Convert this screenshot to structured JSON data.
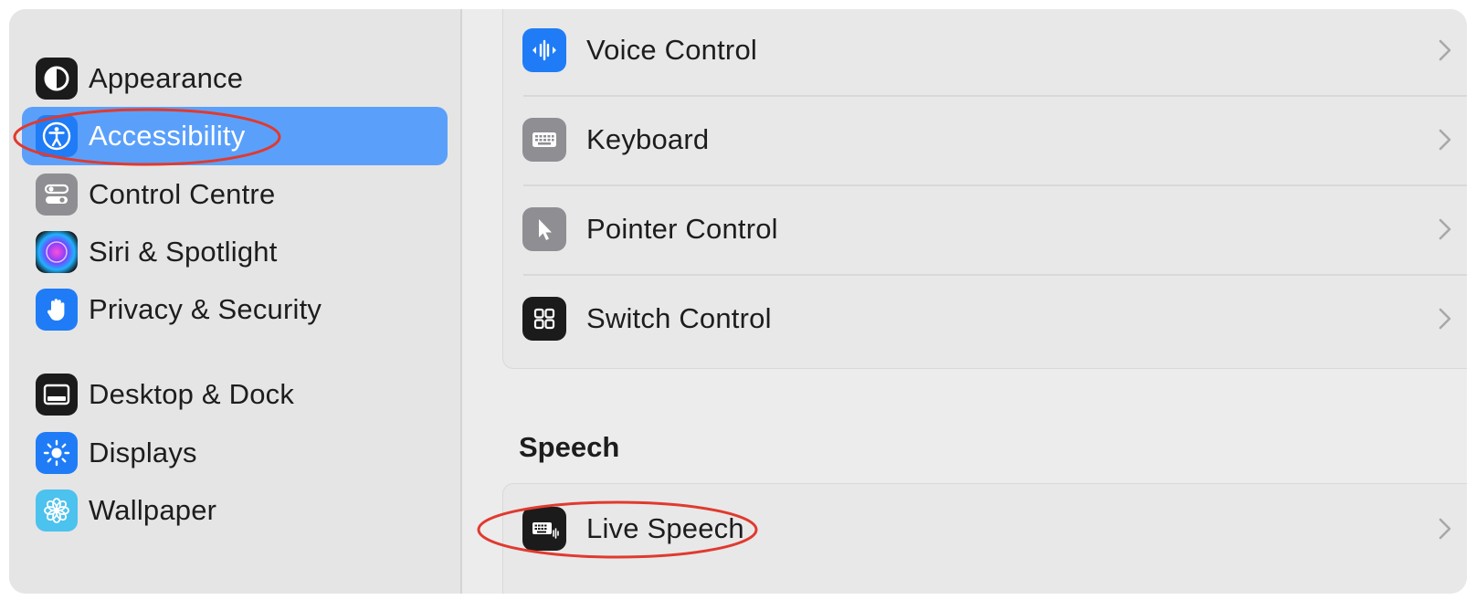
{
  "sidebar": {
    "items": [
      {
        "label": "Appearance",
        "icon": "appearance-icon"
      },
      {
        "label": "Accessibility",
        "icon": "accessibility-icon",
        "selected": true
      },
      {
        "label": "Control Centre",
        "icon": "control-centre-icon"
      },
      {
        "label": "Siri & Spotlight",
        "icon": "siri-icon"
      },
      {
        "label": "Privacy & Security",
        "icon": "hand-icon"
      },
      {
        "label": "Desktop & Dock",
        "icon": "dock-icon"
      },
      {
        "label": "Displays",
        "icon": "brightness-icon"
      },
      {
        "label": "Wallpaper",
        "icon": "flower-icon"
      }
    ]
  },
  "main": {
    "motor_rows": [
      {
        "label": "Voice Control",
        "icon": "waveform-icon"
      },
      {
        "label": "Keyboard",
        "icon": "keyboard-icon"
      },
      {
        "label": "Pointer Control",
        "icon": "pointer-icon"
      },
      {
        "label": "Switch Control",
        "icon": "switch-grid-icon"
      }
    ],
    "speech_section_title": "Speech",
    "speech_rows": [
      {
        "label": "Live Speech",
        "icon": "live-speech-icon"
      }
    ]
  },
  "colors": {
    "selection": "#5aa0fb",
    "annotation": "#e03a2f",
    "accent_blue": "#1f7cf6"
  }
}
